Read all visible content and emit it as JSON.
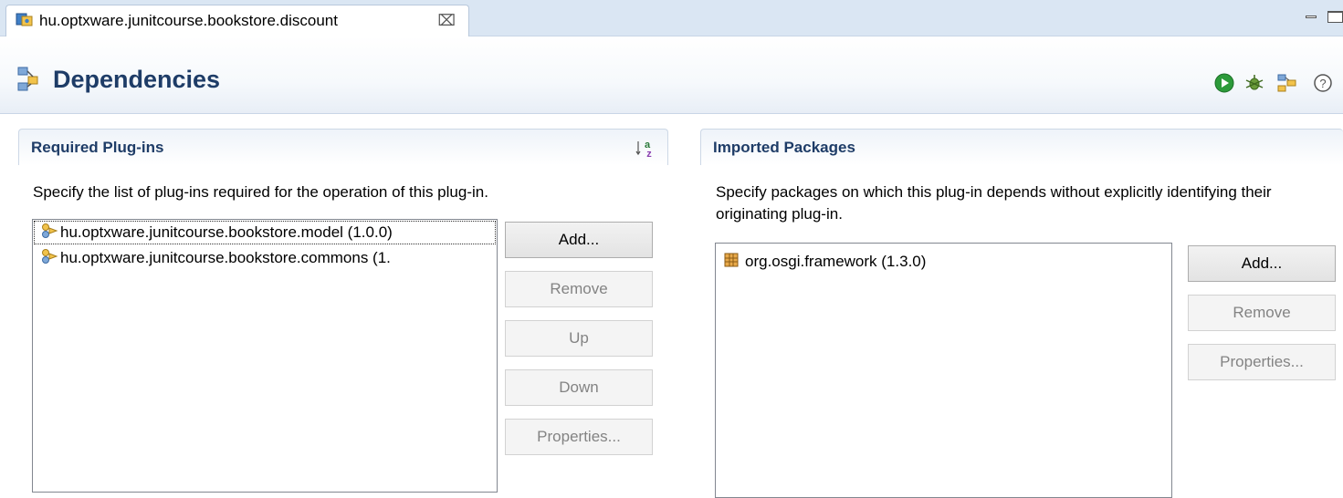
{
  "editor_tab": {
    "title": "hu.optxware.junitcourse.bookstore.discount",
    "close_glyph": "⌧"
  },
  "header": {
    "title": "Dependencies",
    "toolbar_icons": [
      "run-icon",
      "debug-icon",
      "plugin-dependencies-icon",
      "help-icon"
    ]
  },
  "required_plugins": {
    "title": "Required Plug-ins",
    "description": "Specify the list of plug-ins required for the operation of this plug-in.",
    "items": [
      {
        "label": "hu.optxware.junitcourse.bookstore.model (1.0.0)"
      },
      {
        "label": "hu.optxware.junitcourse.bookstore.commons (1."
      }
    ],
    "buttons": {
      "add": "Add...",
      "remove": "Remove",
      "up": "Up",
      "down": "Down",
      "properties": "Properties..."
    }
  },
  "imported_packages": {
    "title": "Imported Packages",
    "description": "Specify packages on which this plug-in depends without explicitly identifying their originating plug-in.",
    "items": [
      {
        "label": "org.osgi.framework (1.3.0)"
      }
    ],
    "buttons": {
      "add": "Add...",
      "remove": "Remove",
      "properties": "Properties..."
    }
  },
  "colors": {
    "title_blue": "#1e3c67",
    "run_green": "#2c9a3a",
    "tab_strip": "#dae6f3"
  }
}
